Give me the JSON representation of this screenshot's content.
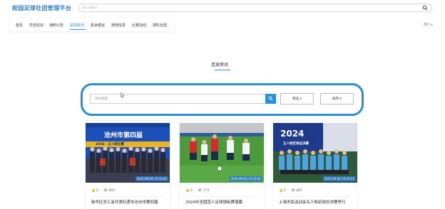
{
  "header": {
    "brand": "校园足球社团管理平台",
    "search_placeholder": "输入关键词"
  },
  "nav": {
    "items": [
      {
        "label": "首页"
      },
      {
        "label": "交流论坛"
      },
      {
        "label": "通知公告"
      },
      {
        "label": "足球资讯",
        "active": true
      },
      {
        "label": "投诉建议"
      },
      {
        "label": "场地信息"
      },
      {
        "label": "比赛活动"
      },
      {
        "label": "球队社团"
      }
    ],
    "user_menu": "用户 ▾",
    "accent": "#2f8fd8"
  },
  "section": {
    "title": "足球资讯"
  },
  "filters": {
    "news_search_placeholder": "资讯搜索",
    "filter_label": "筛选 ▾",
    "sort_label": "排序 ▾",
    "highlight_color": "#2d8ed4"
  },
  "cards": [
    {
      "image_text": "沧州市第四届",
      "banner": "2024 · 五人制比赛",
      "timestamp": "2025-09-04 15:19:41",
      "likes": "0",
      "views": "859",
      "title": "新华区总工会代表队勇夺沧州市第四届"
    },
    {
      "timestamp": "2025-09-04 15:19:41",
      "likes": "0",
      "views": "773",
      "title": "2024年全国盲人足球锦标赛落幕"
    },
    {
      "image_text": "2024",
      "banner": "五人制足球总决赛",
      "timestamp": "2025-09-04 15:19:41",
      "likes": "0",
      "views": "867",
      "title": "上海市民运动会五人制足球总决赛举行"
    }
  ]
}
